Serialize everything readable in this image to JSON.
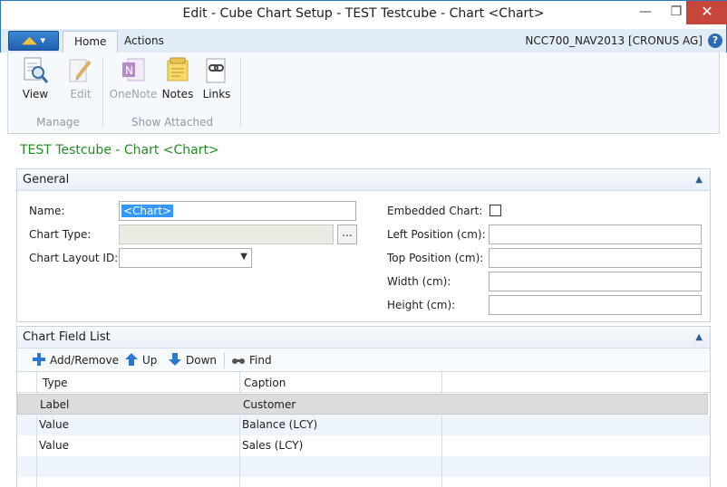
{
  "window": {
    "title": "Edit - Cube Chart Setup - TEST Testcube - Chart <Chart>",
    "minimize": "—",
    "maximize": "❐",
    "close": "✕"
  },
  "menu": {
    "app_button": "▾",
    "tabs": [
      {
        "label": "Home"
      },
      {
        "label": "Actions"
      }
    ],
    "company": "NCC700_NAV2013 [CRONUS AG]",
    "help": "?"
  },
  "ribbon": {
    "buttons": [
      {
        "label": "View",
        "icon": "view-icon",
        "enabled": true
      },
      {
        "label": "Edit",
        "icon": "edit-icon",
        "enabled": false
      },
      {
        "label": "OneNote",
        "icon": "onenote-icon",
        "enabled": false
      },
      {
        "label": "Notes",
        "icon": "notes-icon",
        "enabled": true
      },
      {
        "label": "Links",
        "icon": "links-icon",
        "enabled": true
      }
    ],
    "groups": [
      {
        "label": "Manage"
      },
      {
        "label": "Show Attached"
      }
    ]
  },
  "page": {
    "title": "TEST Testcube - Chart <Chart>"
  },
  "general": {
    "header": "General",
    "fields": {
      "name": {
        "label": "Name:",
        "value": "<Chart>"
      },
      "chart_type": {
        "label": "Chart Type:",
        "value": "",
        "lookup": "..."
      },
      "chart_layout_id": {
        "label": "Chart Layout ID:",
        "value": ""
      },
      "embedded_chart": {
        "label": "Embedded Chart:",
        "checked": false
      },
      "left_position": {
        "label": "Left Position (cm):",
        "value": ""
      },
      "top_position": {
        "label": "Top Position (cm):",
        "value": ""
      },
      "width": {
        "label": "Width (cm):",
        "value": ""
      },
      "height": {
        "label": "Height (cm):",
        "value": ""
      }
    }
  },
  "field_list": {
    "header": "Chart Field List",
    "actions": [
      {
        "label": "Add/Remove",
        "icon": "add-icon"
      },
      {
        "label": "Up",
        "icon": "arrow-up-icon"
      },
      {
        "label": "Down",
        "icon": "arrow-down-icon"
      },
      {
        "label": "Find",
        "icon": "binoculars-icon"
      }
    ],
    "columns": [
      {
        "label": "Type"
      },
      {
        "label": "Caption"
      }
    ],
    "rows": [
      {
        "type": "Label",
        "caption": "Customer"
      },
      {
        "type": "Value",
        "caption": "Balance (LCY)"
      },
      {
        "type": "Value",
        "caption": "Sales (LCY)"
      }
    ]
  },
  "colors": {
    "accent": "#2f75b5",
    "page_title": "#228b22",
    "selection": "#3399ff",
    "close_button": "#c7463c"
  }
}
